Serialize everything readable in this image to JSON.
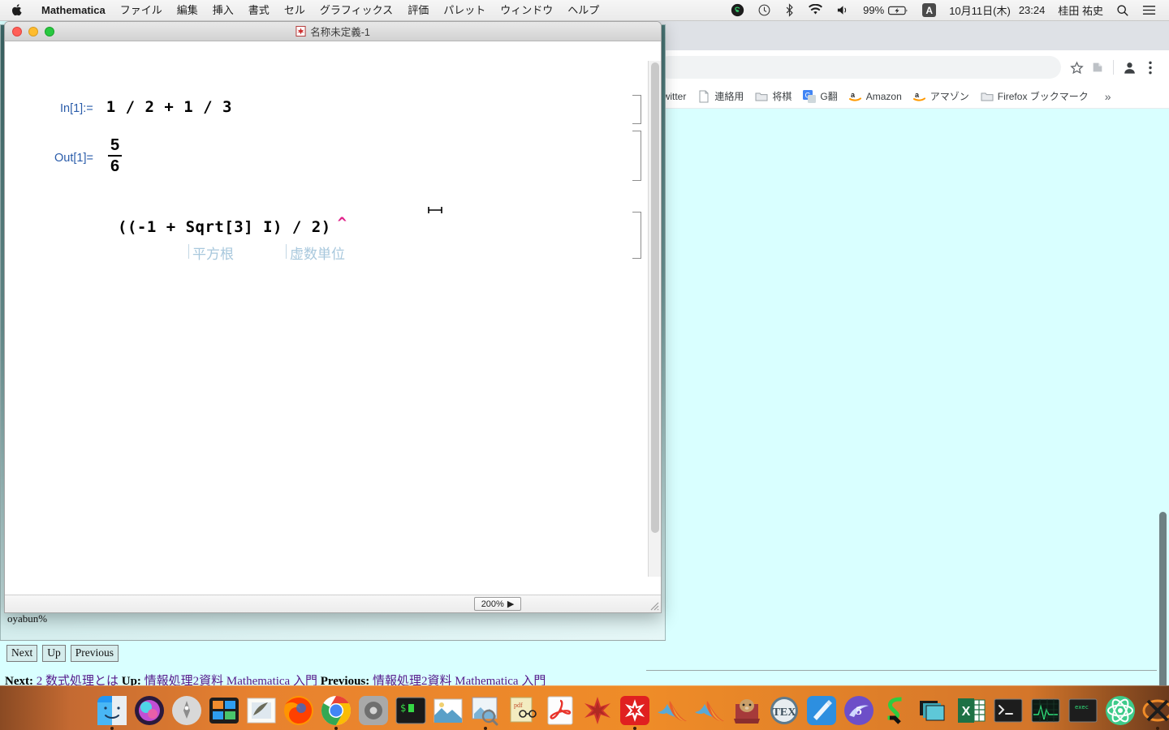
{
  "menubar": {
    "apple_icon": "apple-logo-icon",
    "app_name": "Mathematica",
    "items": [
      "ファイル",
      "編集",
      "挿入",
      "書式",
      "セル",
      "グラフィックス",
      "評価",
      "パレット",
      "ウィンドウ",
      "ヘルプ"
    ],
    "status": {
      "skype_icon": "skype-icon",
      "timemachine_icon": "time-machine-icon",
      "bluetooth_icon": "bluetooth-icon",
      "wifi_icon": "wifi-icon",
      "volume_icon": "volume-icon",
      "battery_percent": "99%",
      "battery_icon": "battery-charging-icon",
      "input_source": "A",
      "date": "10月11日(木)",
      "time": "23:24",
      "user": "桂田 祐史",
      "search_icon": "search-icon",
      "control_center_icon": "control-center-icon"
    }
  },
  "mathematica": {
    "title": "名称未定義-1",
    "title_icon": "notebook-icon",
    "traffic_lights": [
      "close",
      "minimize",
      "zoom"
    ],
    "cells": [
      {
        "prompt": "In[1]:=",
        "input": "1 / 2 + 1 / 3"
      },
      {
        "prompt": "Out[1]=",
        "output_numerator": "5",
        "output_denominator": "6"
      },
      {
        "prompt": "",
        "input": "((-1 + Sqrt[3] I) / 2)",
        "caret": "^",
        "hints": [
          {
            "label": "平方根"
          },
          {
            "label": "虚数単位"
          }
        ]
      }
    ],
    "zoom_level": "200%",
    "zoom_arrow": "▶"
  },
  "terminal": {
    "prompt": "oyabun%"
  },
  "browser": {
    "toolbar": {
      "bookmark_star_icon": "star-icon",
      "extension_icon": "extension-icon",
      "profile_icon": "profile-avatar-icon",
      "menu_icon": "three-dot-menu-icon"
    },
    "bookmarks": [
      {
        "label": "Twitter",
        "icon": "twitter-favicon"
      },
      {
        "label": "連絡用",
        "icon": "page-icon"
      },
      {
        "label": "将棋",
        "icon": "folder-icon"
      },
      {
        "label": "G翻",
        "icon": "google-translate-icon"
      },
      {
        "label": "Amazon",
        "icon": "amazon-icon"
      },
      {
        "label": "アマゾン",
        "icon": "amazon-icon"
      },
      {
        "label": "Firefox ブックマーク",
        "icon": "folder-icon"
      }
    ],
    "overflow": "»"
  },
  "webpage_nav": {
    "buttons": [
      "Next",
      "Up",
      "Previous"
    ],
    "links": [
      {
        "label": "Next:",
        "text": "2 数式処理とは"
      },
      {
        "label": "Up:",
        "text": "情報処理2資料 Mathematica 入門"
      },
      {
        "label": "Previous:",
        "text": "情報処理2資料 Mathematica 入門"
      }
    ]
  },
  "dock": {
    "items": [
      {
        "name": "finder",
        "running": true
      },
      {
        "name": "siri",
        "running": false
      },
      {
        "name": "launchpad",
        "running": false
      },
      {
        "name": "mission-control",
        "running": false
      },
      {
        "name": "mail",
        "running": false
      },
      {
        "name": "firefox",
        "running": false
      },
      {
        "name": "chrome",
        "running": true
      },
      {
        "name": "system-preferences",
        "running": false
      },
      {
        "name": "terminal",
        "running": true
      },
      {
        "name": "photos",
        "running": false
      },
      {
        "name": "preview",
        "running": true
      },
      {
        "name": "skim-pdf",
        "running": false
      },
      {
        "name": "adobe-acrobat",
        "running": false
      },
      {
        "name": "mathematica-player",
        "running": false
      },
      {
        "name": "mathematica",
        "running": true
      },
      {
        "name": "matlab",
        "running": false
      },
      {
        "name": "matlab-2",
        "running": false
      },
      {
        "name": "dictionary",
        "running": false
      },
      {
        "name": "tex",
        "running": false
      },
      {
        "name": "xcode",
        "running": false
      },
      {
        "name": "maple",
        "running": false
      },
      {
        "name": "scilab",
        "running": false
      },
      {
        "name": "keynote",
        "running": false
      },
      {
        "name": "excel",
        "running": false
      },
      {
        "name": "iterm",
        "running": false
      },
      {
        "name": "activity-monitor",
        "running": false
      },
      {
        "name": "exec-terminal",
        "running": false
      },
      {
        "name": "atom",
        "running": false
      },
      {
        "name": "xquartz",
        "running": true
      }
    ],
    "trash": "trash-icon"
  },
  "colors": {
    "desktop": "#d9ffff",
    "prompt_blue": "#2a5caa",
    "caret_pink": "#e0218a",
    "hint_blue": "#a8c8dd",
    "dock_orange": "#ef8c28"
  }
}
